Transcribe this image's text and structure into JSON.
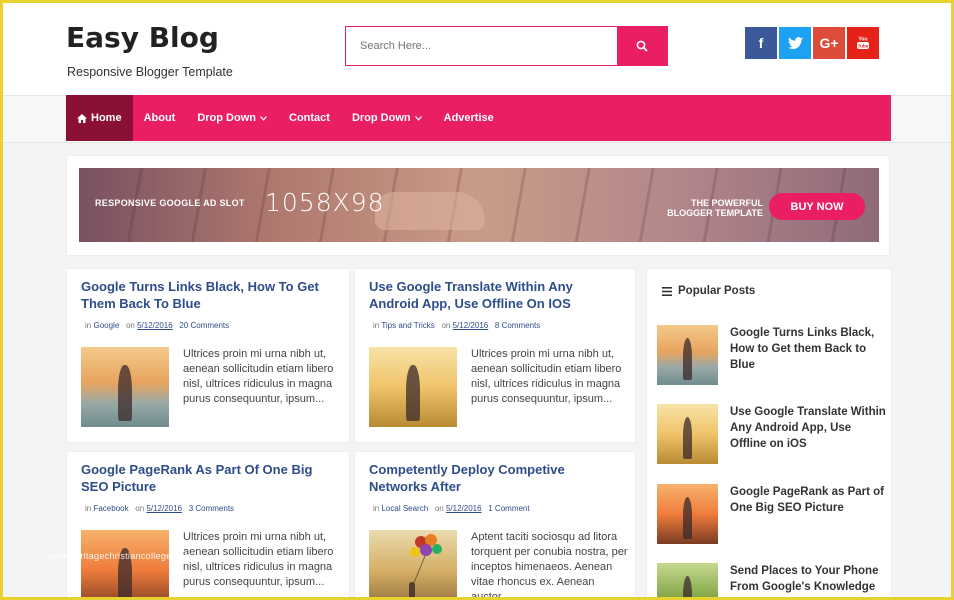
{
  "header": {
    "logo": "Easy Blog",
    "tagline": "Responsive Blogger Template",
    "search_placeholder": "Search Here...",
    "socials": [
      {
        "label": "f",
        "icon": "facebook-icon"
      },
      {
        "label": "twitter",
        "icon": "twitter-icon"
      },
      {
        "label": "G+",
        "icon": "google-plus-icon"
      },
      {
        "label": "You Tube",
        "icon": "youtube-icon"
      }
    ]
  },
  "nav": {
    "items": [
      {
        "label": "Home",
        "icon": "home-icon",
        "active": true
      },
      {
        "label": "About"
      },
      {
        "label": "Drop Down",
        "dropdown": true
      },
      {
        "label": "Contact"
      },
      {
        "label": "Drop Down",
        "dropdown": true
      },
      {
        "label": "Advertise"
      }
    ]
  },
  "ad": {
    "slot_text": "RESPONSIVE GOOGLE AD SLOT",
    "size_text": "1058X98",
    "powerful_text": "THE POWERFUL BLOGGER TEMPLATE",
    "buy_label": "BUY NOW"
  },
  "posts": [
    {
      "title": "Google Turns Links Black, How To Get Them Back To Blue",
      "in_label": "in",
      "category": "Google",
      "on_label": "on",
      "date": "5/12/2016",
      "comments": "20 Comments",
      "excerpt": "Ultrices proin mi urna nibh ut, aenean sollicitudin etiam libero nisl, ultrices ridiculus in magna purus consequuntur, ipsum..."
    },
    {
      "title": "Use Google Translate Within Any Android App, Use Offline On IOS",
      "in_label": "in",
      "category": "Tips and Tricks",
      "on_label": "on",
      "date": "5/12/2016",
      "comments": "8 Comments",
      "excerpt": "Ultrices proin mi urna nibh ut, aenean sollicitudin etiam libero nisl, ultrices ridiculus in magna purus consequuntur, ipsum..."
    },
    {
      "title": "Google PageRank As Part Of One Big SEO Picture",
      "in_label": "in",
      "category": "Facebook",
      "on_label": "on",
      "date": "5/12/2016",
      "comments": "3 Comments",
      "excerpt": "Ultrices proin mi urna nibh ut, aenean sollicitudin etiam libero nisl, ultrices ridiculus in magna purus consequuntur, ipsum..."
    },
    {
      "title": "Competently Deploy Competive Networks After",
      "in_label": "in",
      "category": "Local Search",
      "on_label": "on",
      "date": "5/12/2016",
      "comments": "1 Comment",
      "excerpt": "Aptent taciti sociosqu ad litora torquent per conubia nostra, per inceptos himenaeos. Aenean vitae rhoncus ex. Aenean auctor..."
    }
  ],
  "sidebar": {
    "heading": "Popular Posts",
    "popular": [
      "Google Turns Links Black, How to Get them Back to Blue",
      "Use Google Translate Within Any Android App, Use Offline on iOS",
      "Google PageRank as Part of One Big SEO Picture",
      "Send Places to Your Phone From Google's Knowledge Graph Cards"
    ]
  },
  "watermark": "www.heritagechristiancollege.com",
  "colors": {
    "accent": "#e91e63",
    "nav_active": "#8a1035",
    "title_blue": "#2e4d8a",
    "frame": "#e8d230"
  }
}
